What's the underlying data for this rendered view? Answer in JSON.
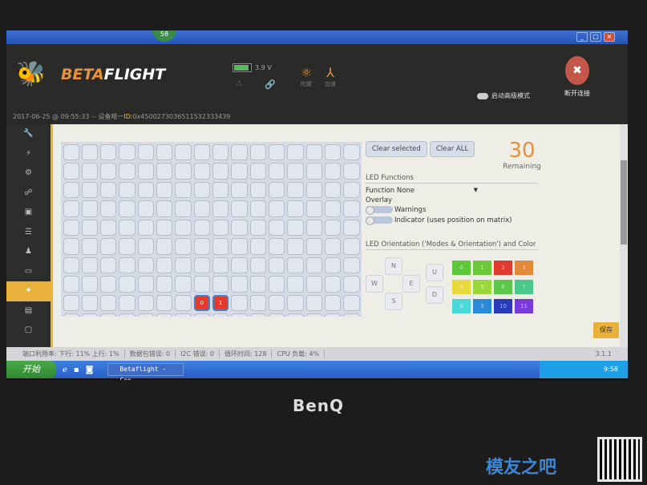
{
  "window": {
    "badge": "58",
    "min": "_",
    "max": "□",
    "close": "×"
  },
  "header": {
    "brand_a": "BETA",
    "brand_b": "FLIGHT",
    "battery": {
      "voltage": "3.9 V",
      "level": 0.8
    },
    "sensors": [
      {
        "label": "陀螺"
      },
      {
        "label": "加速"
      }
    ],
    "expert_mode": "启动高级模式",
    "disconnect": "断开连接",
    "device_info_prefix": "2017-06-25 @ 09:55:33 -- 设备唯一",
    "device_id": "ID:",
    "device_id_value": "0x4500273036511532333439"
  },
  "sidebar": {
    "items": [
      "setup",
      "ports",
      "configuration",
      "receiver",
      "modes",
      "adjustments",
      "servos",
      "osd",
      "led-strip",
      "sensors",
      "cli"
    ],
    "active": "led-strip"
  },
  "led": {
    "grid_columns": 16,
    "grid_rows": 10,
    "placed": [
      {
        "row": 8,
        "col": 7,
        "label": "0"
      },
      {
        "row": 8,
        "col": 8,
        "label": "1"
      }
    ],
    "clear_selected": "Clear selected",
    "clear_all": "Clear ALL",
    "remaining_count": "30",
    "remaining_label": "Remaining",
    "functions_title": "LED Functions",
    "function_label": "Function",
    "function_value": "None",
    "overlay_label": "Overlay",
    "warnings": "Warnings",
    "indicator": "Indicator (uses position on matrix)",
    "orientation_title": "LED Orientation ('Modes & Orientation') and Color",
    "directions": [
      "N",
      "W",
      "E",
      "S",
      "U",
      "D"
    ],
    "colors": [
      {
        "label": "0",
        "hex": "#5cc83a"
      },
      {
        "label": "1",
        "hex": "#6cc83a"
      },
      {
        "label": "2",
        "hex": "#e03a2e"
      },
      {
        "label": "3",
        "hex": "#e08a3a"
      },
      {
        "label": "4",
        "hex": "#e8d83a"
      },
      {
        "label": "5",
        "hex": "#9ad83a"
      },
      {
        "label": "6",
        "hex": "#5cc84a"
      },
      {
        "label": "7",
        "hex": "#4ac88a"
      },
      {
        "label": "8",
        "hex": "#4ad8d8"
      },
      {
        "label": "9",
        "hex": "#2a8ad8"
      },
      {
        "label": "10",
        "hex": "#2a3ab8"
      },
      {
        "label": "11",
        "hex": "#7a3ad8"
      }
    ],
    "save": "保存"
  },
  "status": {
    "port": "端口利用率: 下行: 11% 上行: 1%",
    "packet_error": "数据包错误: 0",
    "i2c_error": "I2C 错误: 0",
    "cycle": "循环时间: 128",
    "cpu": "CPU 负载: 4%",
    "version": "3.1.1"
  },
  "taskbar": {
    "start": "开始",
    "task": "Betaflight - Con...",
    "clock": "9:58"
  },
  "bezel": {
    "brand": "BenQ",
    "watermark": "模友之吧"
  }
}
